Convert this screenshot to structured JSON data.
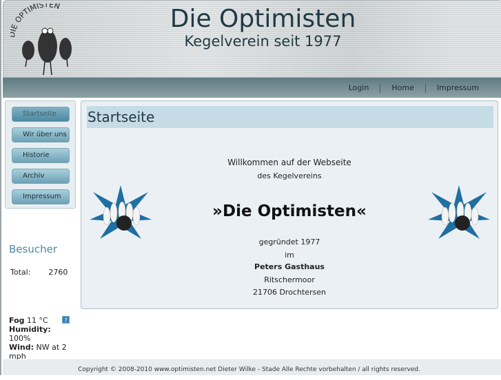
{
  "header": {
    "title": "Die Optimisten",
    "subtitle": "Kegelverein seit 1977",
    "logo_text": "DIE OPTIMISTEN"
  },
  "nav": [
    "Login",
    "Home",
    "Impressum"
  ],
  "sidebar": {
    "items": [
      "Startseite",
      "Wir über uns",
      "Historie",
      "Archiv",
      "Impressum"
    ],
    "active": "Startseite"
  },
  "visitors": {
    "title": "Besucher",
    "total_label": "Total:",
    "total_value": "2760"
  },
  "weather": {
    "condition": "Fog",
    "temp": "11",
    "unit": "°C",
    "humidity_label": "Humidity:",
    "humidity": "100%",
    "wind_label": "Wind:",
    "wind": "NW at 2 mph",
    "help": "?"
  },
  "main": {
    "heading": "Startseite",
    "welcome1": "Willkommen auf der Webseite",
    "welcome2": "des Kegelvereins",
    "club": "»Die Optimisten«",
    "founded": "gegründet 1977",
    "im": "im",
    "venue": "Peters Gasthaus",
    "street": "Ritschermoor",
    "city": "21706 Drochtersen"
  },
  "footer": "Copyright © 2008-2010 www.optimisten.net  Dieter Wilke - Stade  Alle Rechte vorbehalten / all rights reserved."
}
